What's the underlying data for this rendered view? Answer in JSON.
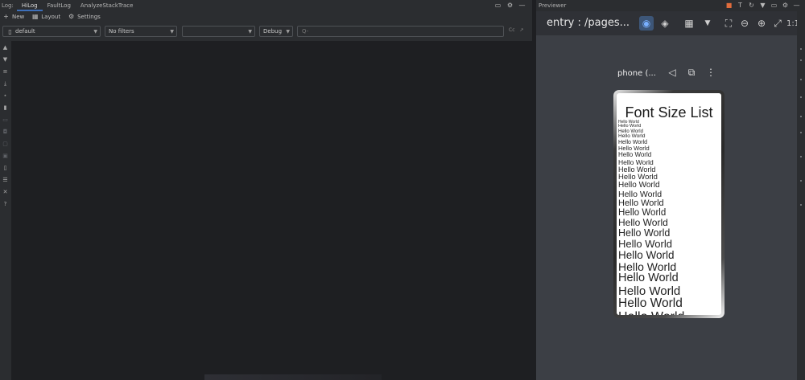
{
  "log": {
    "prefix": "Log:",
    "tabs": [
      {
        "label": "HiLog",
        "active": true
      },
      {
        "label": "FaultLog",
        "active": false
      },
      {
        "label": "AnalyzeStackTrace",
        "active": false
      }
    ],
    "toolbar": {
      "new_label": "New",
      "layout_label": "Layout",
      "settings_label": "Settings"
    },
    "filters": {
      "device_value": "default",
      "filter_value": "No filters",
      "process_value": "",
      "level_value": "Debug",
      "search_placeholder": "Q-",
      "search_extra_1": "Cc",
      "search_extra_2": "↗"
    }
  },
  "previewer": {
    "header_title": "Previewer",
    "route": "entry : /pages...",
    "device_name": "phone (...",
    "screen": {
      "title": "Font Size List",
      "item_label": "Hello World",
      "items": [
        {
          "text": "Hello World",
          "size": 5
        },
        {
          "text": "Hello World",
          "size": 5.5
        },
        {
          "text": "Hello World",
          "size": 6
        },
        {
          "text": "Hello World",
          "size": 6.5
        },
        {
          "text": "Hello World",
          "size": 7
        },
        {
          "text": "Hello World",
          "size": 7.5
        },
        {
          "text": "Hello World",
          "size": 8
        },
        {
          "text": "Hello World",
          "size": 8.5
        },
        {
          "text": "Hello World",
          "size": 9
        },
        {
          "text": "Hello World",
          "size": 9.5
        },
        {
          "text": "Hello World",
          "size": 10
        },
        {
          "text": "Hello World",
          "size": 10.5
        },
        {
          "text": "Hello World",
          "size": 11
        },
        {
          "text": "Hello World",
          "size": 11.5
        },
        {
          "text": "Hello World",
          "size": 12
        },
        {
          "text": "Hello World",
          "size": 12.5
        },
        {
          "text": "Hello World",
          "size": 13
        },
        {
          "text": "Hello World",
          "size": 13.5
        },
        {
          "text": "Hello World",
          "size": 14
        },
        {
          "text": "Hello World",
          "size": 14.5
        },
        {
          "text": "Hello World",
          "size": 15
        },
        {
          "text": "Hello World",
          "size": 15.5
        },
        {
          "text": "Hello World",
          "size": 16
        }
      ]
    }
  },
  "colors": {
    "accent": "#3d6fb9",
    "log_bg": "#1e1f22",
    "panel_bg": "#2b2d30",
    "previewer_bg": "#3c3f45"
  }
}
